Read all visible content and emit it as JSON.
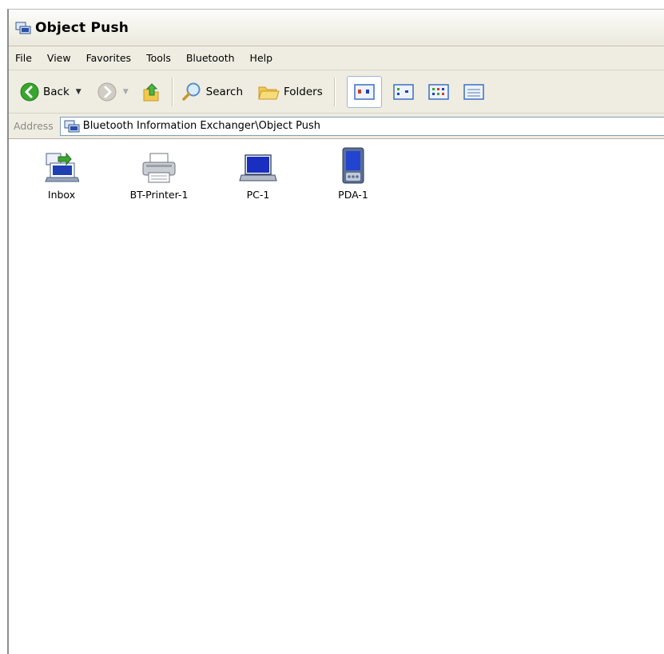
{
  "window": {
    "title": "Object Push"
  },
  "menu": [
    "File",
    "View",
    "Favorites",
    "Tools",
    "Bluetooth",
    "Help"
  ],
  "toolbar": {
    "back_label": "Back",
    "search_label": "Search",
    "folders_label": "Folders"
  },
  "address": {
    "label": "Address",
    "path": "Bluetooth Information Exchanger\\Object Push"
  },
  "items": [
    {
      "label": "Inbox",
      "icon": "inbox-icon"
    },
    {
      "label": "BT-Printer-1",
      "icon": "printer-icon"
    },
    {
      "label": "PC-1",
      "icon": "laptop-icon"
    },
    {
      "label": "PDA-1",
      "icon": "pda-icon"
    }
  ],
  "colors": {
    "chrome": "#efede2",
    "back_green": "#3aa52f",
    "device_blue": "#1f3fb5",
    "selection_border": "#9fb5d4"
  }
}
